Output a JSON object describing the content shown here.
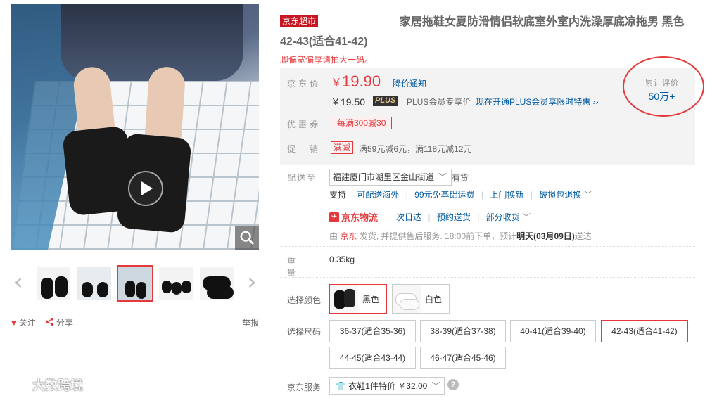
{
  "gallery": {
    "thumb_count": 5,
    "active_thumb": 2,
    "left_arrow": "‹",
    "right_arrow": "›",
    "follow_label": "关注",
    "share_label": "分享",
    "report_label": "举报"
  },
  "product": {
    "market_badge": "京东超市",
    "title": "家居拖鞋女夏防滑情侣软底室外室内洗澡厚底凉拖男 黑色 42-43(适合41-42)",
    "promo_line": "脚偏宽偏厚请拍大一码。"
  },
  "summary": {
    "price_label": "京东价",
    "price_currency": "￥",
    "price_value": "19.90",
    "notify_label": "降价通知",
    "plus_price": "￥19.50",
    "plus_badge": "PLUS",
    "plus_text": "PLUS会员专享价",
    "plus_link": "现在开通PLUS会员享限时特惠 ››",
    "coupon_label": "优惠券",
    "coupon_value": "每满300减30",
    "promo_label": "促销",
    "promo_tag": "满减",
    "promo_text": "满59元减6元，满118元减12元",
    "review_title": "累计评价",
    "review_count": "50万+"
  },
  "delivery": {
    "label": "配送至",
    "address": "福建厦门市湖里区金山街道",
    "stock": "有货",
    "support_label": "支持",
    "services": [
      "可配送海外",
      "99元免基础运费",
      "上门换新",
      "破损包退换"
    ],
    "logistics_brand": "京东物流",
    "logistics_items": [
      "次日达",
      "预约送货",
      "部分收货"
    ],
    "ship_from_prefix": "由",
    "ship_from_seller": "京东",
    "ship_from_text": "发货, 并提供售后服务. 18:00前下单，预计",
    "ship_date": "明天(03月09日)",
    "ship_suffix": "送达"
  },
  "weight": {
    "label": "重量",
    "value": "0.35kg"
  },
  "color": {
    "label": "选择颜色",
    "options": [
      {
        "name": "黑色",
        "selected": true
      },
      {
        "name": "白色",
        "selected": false
      }
    ]
  },
  "size": {
    "label": "选择尺码",
    "options": [
      "36-37(适合35-36)",
      "38-39(适合37-38)",
      "40-41(适合39-40)",
      "42-43(适合41-42)",
      "44-45(适合43-44)",
      "46-47(适合45-46)"
    ],
    "selected_index": 3
  },
  "service": {
    "label": "京东服务",
    "value": "衣鞋1件特价 ￥32.00",
    "help": "?"
  },
  "watermark": {
    "text": "大数跨境"
  },
  "colors": {
    "accent": "#e4393c",
    "link": "#005aa0",
    "bg_summary": "#f3f3f3"
  }
}
